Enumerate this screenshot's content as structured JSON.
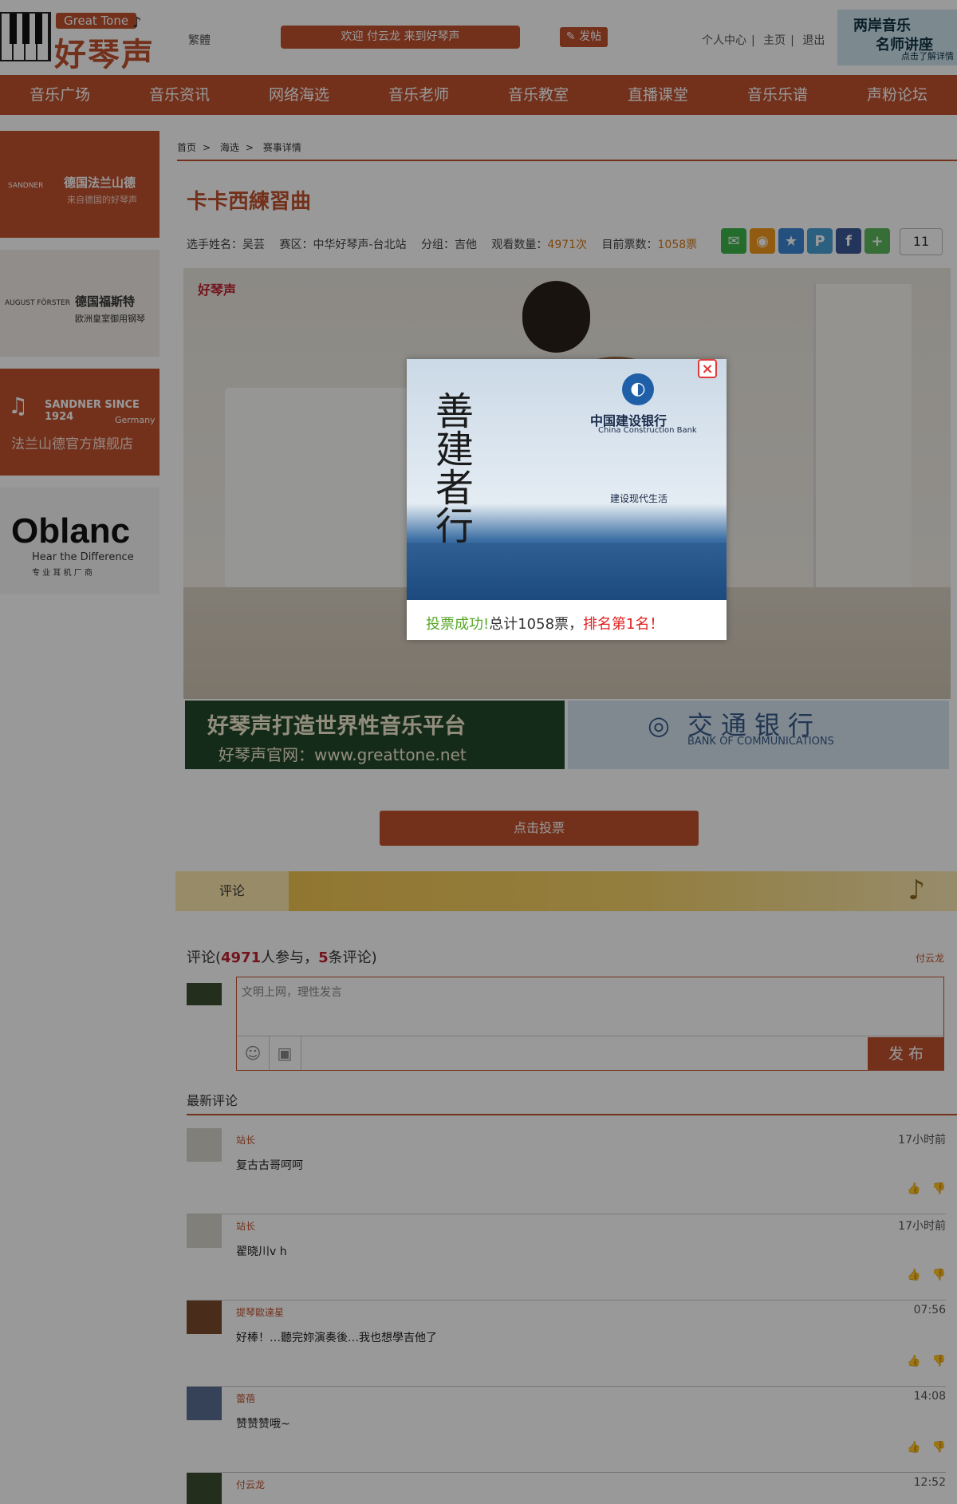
{
  "header": {
    "logo_eng": "Great Tone",
    "logo_cn": "好琴声",
    "lang_switch": "繁體",
    "welcome": "欢迎 付云龙 来到好琴声",
    "post_button": "发帖",
    "links": [
      "个人中心",
      "主页",
      "退出"
    ],
    "banner": {
      "line1": "两岸音乐",
      "line2": "名师讲座",
      "line3": "点击了解详情"
    }
  },
  "nav": [
    "音乐广场",
    "音乐资讯",
    "网络海选",
    "音乐老师",
    "音乐教室",
    "直播课堂",
    "音乐乐谱",
    "声粉论坛"
  ],
  "sidebar_ads": [
    {
      "title": "德国法兰山德",
      "sub": "来自德国的好琴声",
      "brand": "SANDNER"
    },
    {
      "title": "德国福斯特",
      "sub": "欧洲皇室御用钢琴",
      "brand": "AUGUST FÖRSTER"
    },
    {
      "title": "SANDNER SINCE 1924",
      "sub": "Germany",
      "cn": "法兰山德官方旗舰店"
    },
    {
      "title": "Oblanc",
      "sub": "Hear the Difference",
      "cn": "专 业 耳 机 厂 商"
    }
  ],
  "breadcrumb": [
    "首页",
    "海选",
    "赛事详情"
  ],
  "page_title": "卡卡西練習曲",
  "meta": {
    "player_label": "选手姓名：",
    "player": "吴芸",
    "region_label": "赛区：",
    "region": "中华好琴声-台北站",
    "group_label": "分组：",
    "group": "吉他",
    "views_label": "观看数量：",
    "views": "4971次",
    "votes_label": "目前票数：",
    "votes": "1058票"
  },
  "share": {
    "icons": [
      "wechat-icon",
      "weibo-icon",
      "qzone-icon",
      "pinterest-icon",
      "facebook-icon",
      "more-icon"
    ],
    "count": "11"
  },
  "video": {
    "watermark": "好琴声"
  },
  "ad_strips": {
    "left_line1": "好琴声打造世界性音乐平台",
    "left_line2": "好琴声官网：www.greattone.net",
    "right_cn": "交通银行",
    "right_en": "BANK OF COMMUNICATIONS"
  },
  "modal": {
    "bank_cn": "中国建设银行",
    "bank_en": "China Construction Bank",
    "slogan": "善建者行",
    "tagline": "建设现代生活",
    "msg_success": "投票成功!",
    "msg_total": "总计1058票，",
    "msg_rank": "排名第1名！"
  },
  "vote_button": "点击投票",
  "comments_tab": "评论",
  "comment_count": {
    "prefix": "评论(",
    "participants": "4971",
    "mid": "人参与，",
    "comments": "5",
    "suffix": "条评论)"
  },
  "current_user": "付云龙",
  "comment_input": {
    "placeholder": "文明上网，理性发言",
    "publish": "发 布"
  },
  "latest_label": "最新评论",
  "comments": [
    {
      "name": "站长",
      "text": "复古古哥呵呵",
      "time": "17小时前"
    },
    {
      "name": "站长",
      "text": "翟晓川v h",
      "time": "17小时前"
    },
    {
      "name": "提琴歐達星",
      "text": "好棒！…聽完妳演奏後…我也想學吉他了",
      "time": "07:56"
    },
    {
      "name": "蕾蓓",
      "text": "赞赞赞哦~",
      "time": "14:08"
    },
    {
      "name": "付云龙",
      "text": "",
      "time": "12:52"
    }
  ],
  "colors": {
    "brand": "#c0522f",
    "accent": "#d3791c",
    "highlight": "#c0222f"
  }
}
